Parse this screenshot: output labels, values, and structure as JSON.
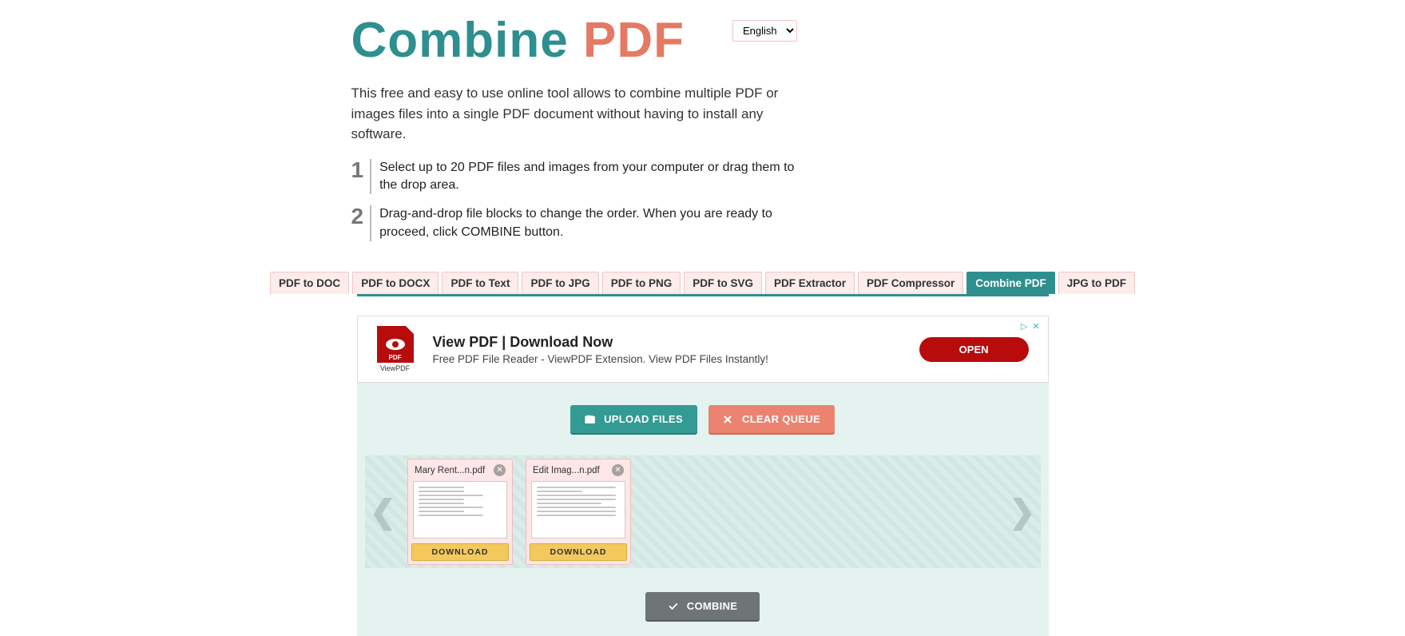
{
  "logo": {
    "part1": "Combine",
    "part2": "PDF"
  },
  "language": {
    "selected": "English",
    "options": [
      "English"
    ]
  },
  "description": "This free and easy to use online tool allows to combine multiple PDF or images files into a single PDF document without having to install any software.",
  "steps": [
    {
      "num": "1",
      "text": "Select up to 20 PDF files and images from your computer or drag them to the drop area."
    },
    {
      "num": "2",
      "text": "Drag-and-drop file blocks to change the order. When you are ready to proceed, click COMBINE button."
    }
  ],
  "tabs": [
    {
      "label": "PDF to DOC",
      "active": false
    },
    {
      "label": "PDF to DOCX",
      "active": false
    },
    {
      "label": "PDF to Text",
      "active": false
    },
    {
      "label": "PDF to JPG",
      "active": false
    },
    {
      "label": "PDF to PNG",
      "active": false
    },
    {
      "label": "PDF to SVG",
      "active": false
    },
    {
      "label": "PDF Extractor",
      "active": false
    },
    {
      "label": "PDF Compressor",
      "active": false
    },
    {
      "label": "Combine PDF",
      "active": true
    },
    {
      "label": "JPG to PDF",
      "active": false
    }
  ],
  "ad": {
    "icon_badge": "PDF",
    "icon_sub": "ViewPDF",
    "title": "View PDF | Download Now",
    "subtitle": "Free PDF File Reader - ViewPDF Extension. View PDF Files Instantly!",
    "cta": "OPEN"
  },
  "buttons": {
    "upload": "UPLOAD FILES",
    "clear": "CLEAR QUEUE",
    "combine": "COMBINE",
    "download": "DOWNLOAD"
  },
  "files": [
    {
      "name": "Mary Rent...n.pdf"
    },
    {
      "name": "Edit Imag...n.pdf"
    }
  ],
  "nav": {
    "prev": "❮",
    "next": "❯"
  }
}
